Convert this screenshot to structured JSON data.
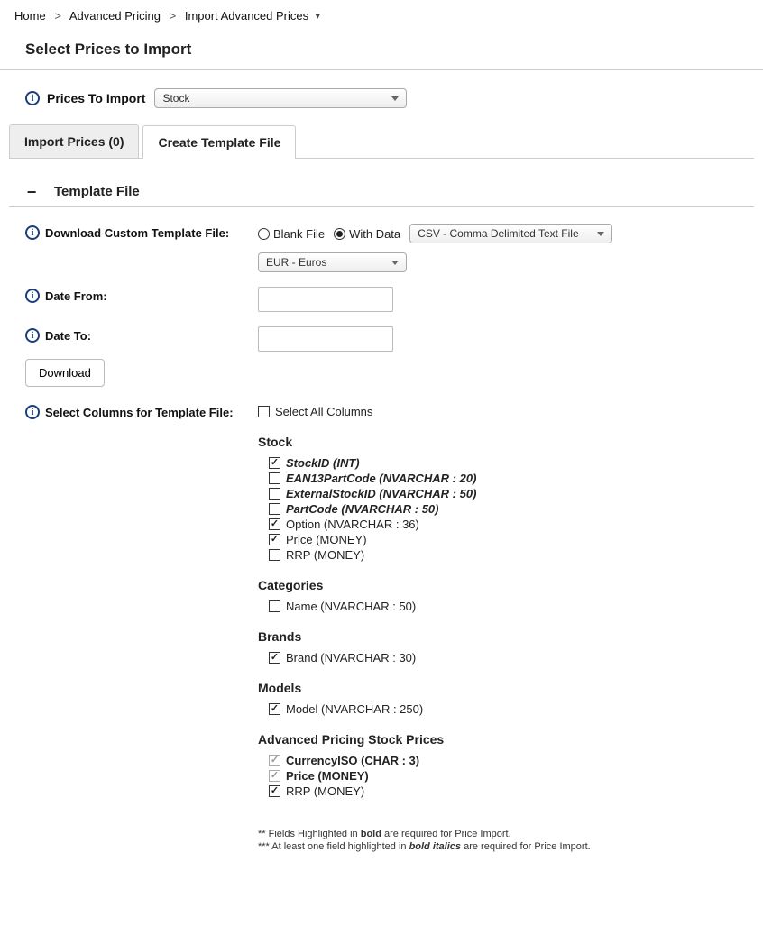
{
  "breadcrumb": {
    "home": "Home",
    "advanced_pricing": "Advanced Pricing",
    "import_advanced_prices": "Import Advanced Prices"
  },
  "page_title": "Select Prices to Import",
  "prices_to_import": {
    "label": "Prices To Import",
    "selected": "Stock"
  },
  "tabs": {
    "import_prices": "Import Prices (0)",
    "create_template": "Create Template File"
  },
  "section": {
    "template_file": "Template File"
  },
  "form": {
    "download_custom_label": "Download Custom Template File:",
    "radio_blank": "Blank File",
    "radio_with_data": "With Data",
    "format_selected": "CSV - Comma Delimited Text File",
    "currency_selected": "EUR - Euros",
    "date_from_label": "Date From:",
    "date_to_label": "Date To:",
    "download_btn": "Download",
    "select_columns_label": "Select Columns for Template File:",
    "select_all_label": "Select All Columns"
  },
  "column_groups": [
    {
      "title": "Stock",
      "items": [
        {
          "label": "StockID (INT)",
          "style": "bolditalic",
          "checked": true
        },
        {
          "label": "EAN13PartCode (NVARCHAR : 20)",
          "style": "bolditalic",
          "checked": false
        },
        {
          "label": "ExternalStockID (NVARCHAR : 50)",
          "style": "bolditalic",
          "checked": false
        },
        {
          "label": "PartCode (NVARCHAR : 50)",
          "style": "bolditalic",
          "checked": false
        },
        {
          "label": "Option (NVARCHAR : 36)",
          "style": "",
          "checked": true
        },
        {
          "label": "Price (MONEY)",
          "style": "",
          "checked": true
        },
        {
          "label": "RRP (MONEY)",
          "style": "",
          "checked": false
        }
      ]
    },
    {
      "title": "Categories",
      "items": [
        {
          "label": "Name (NVARCHAR : 50)",
          "style": "",
          "checked": false
        }
      ]
    },
    {
      "title": "Brands",
      "items": [
        {
          "label": "Brand (NVARCHAR : 30)",
          "style": "",
          "checked": true
        }
      ]
    },
    {
      "title": "Models",
      "items": [
        {
          "label": "Model (NVARCHAR : 250)",
          "style": "",
          "checked": true
        }
      ]
    },
    {
      "title": "Advanced Pricing Stock Prices",
      "items": [
        {
          "label": "CurrencyISO (CHAR : 3)",
          "style": "bold",
          "checked": true,
          "disabled": true
        },
        {
          "label": "Price (MONEY)",
          "style": "bold",
          "checked": true,
          "disabled": true
        },
        {
          "label": "RRP (MONEY)",
          "style": "",
          "checked": true
        }
      ]
    }
  ],
  "footnotes": {
    "line1_pre": "** Fields Highlighted in ",
    "line1_bold": "bold",
    "line1_post": " are required for Price Import.",
    "line2_pre": "*** At least one field highlighted in ",
    "line2_bi": "bold italics",
    "line2_post": " are required for Price Import."
  }
}
